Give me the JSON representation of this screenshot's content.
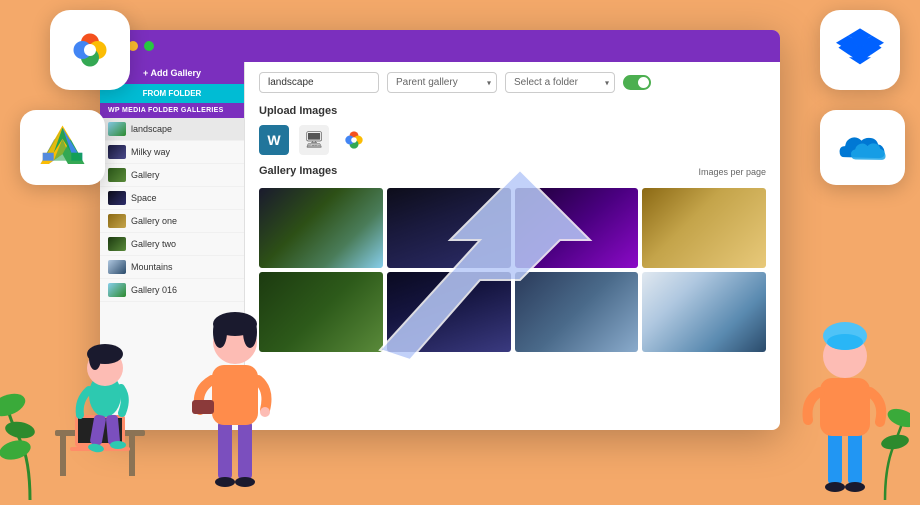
{
  "background_color": "#F4A96A",
  "browser": {
    "titlebar_color": "#7B2FBE",
    "dots": [
      "red",
      "yellow",
      "green"
    ]
  },
  "sidebar": {
    "add_gallery_label": "+ Add Gallery",
    "from_folder_label": "FROM FOLDER",
    "section_title": "WP MEDIA FOLDER GALLERIES",
    "items": [
      {
        "label": "landscape",
        "thumb_class": "st-landscape"
      },
      {
        "label": "Milky way",
        "thumb_class": "st-milkyway"
      },
      {
        "label": "Gallery",
        "thumb_class": "st-gallery"
      },
      {
        "label": "Space",
        "thumb_class": "st-space"
      },
      {
        "label": "Gallery one",
        "thumb_class": "st-gallone"
      },
      {
        "label": "Gallery two",
        "thumb_class": "st-galltwo"
      },
      {
        "label": "Mountains",
        "thumb_class": "st-mountains"
      },
      {
        "label": "Gallery 016",
        "thumb_class": "st-landscape"
      }
    ]
  },
  "toolbar": {
    "gallery_name_value": "landscape",
    "gallery_name_placeholder": "landscape",
    "parent_gallery_placeholder": "Parent gallery",
    "select_folder_placeholder": "Select a folder",
    "toggle_on": true
  },
  "upload_section": {
    "label": "Upload Images",
    "icons": [
      "wordpress",
      "monitor",
      "google-photos"
    ]
  },
  "gallery_section": {
    "label": "Gallery Images",
    "images_per_page_label": "Images per page",
    "thumbs": [
      {
        "class": "thumb-1"
      },
      {
        "class": "thumb-2"
      },
      {
        "class": "thumb-3"
      },
      {
        "class": "thumb-4"
      },
      {
        "class": "thumb-5"
      },
      {
        "class": "thumb-6"
      },
      {
        "class": "thumb-7"
      },
      {
        "class": "thumb-8"
      }
    ]
  },
  "cloud_services": {
    "dropbox": "Dropbox",
    "onedrive": "OneDrive",
    "gphotos": "Google Photos",
    "gdrive": "Google Drive"
  }
}
